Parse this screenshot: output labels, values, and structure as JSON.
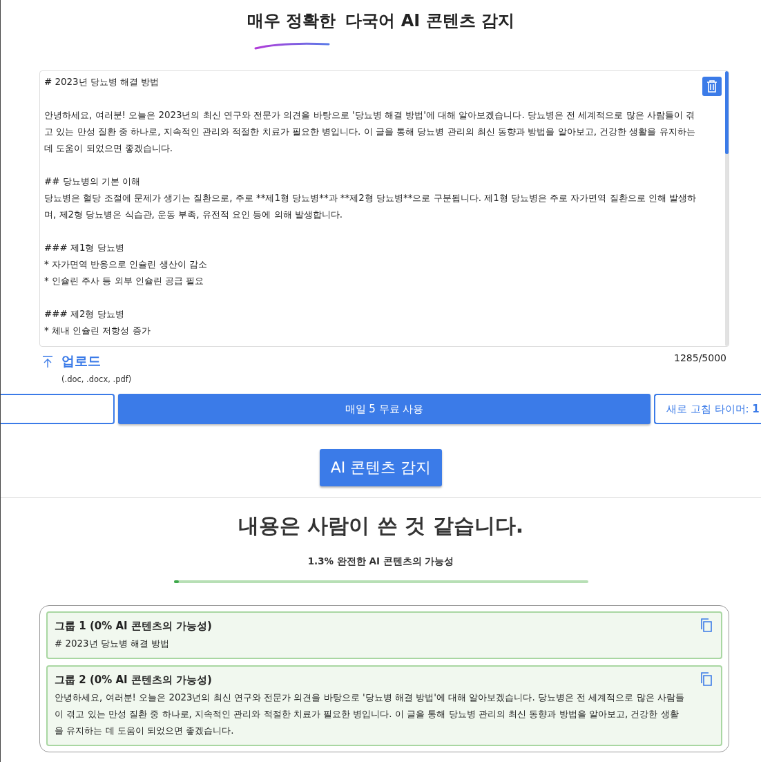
{
  "header": {
    "title_highlight": "매우 정확한",
    "title_rest": "다국어 AI 콘텐츠 감지"
  },
  "editor": {
    "blocks": [
      [
        "# 2023년 당뇨병 해결 방법"
      ],
      [
        "안녕하세요, 여러분! 오늘은 2023년의 최신 연구와 전문가 의견을 바탕으로 '당뇨병 해결 방법'에 대해 알아보겠습니다. 당뇨병은 전 세계적으로 많은 사람들이 겪고 있는 만성 질환 중 하나로, 지속적인 관리와 적절한 치료가 필요한 병입니다. 이 글을 통해 당뇨병 관리의 최신 동향과 방법을 알아보고, 건강한 생활을 유지하는 데 도움이 되었으면 좋겠습니다."
      ],
      [
        "## 당뇨병의 기본 이해",
        "당뇨병은 혈당 조절에 문제가 생기는 질환으로, 주로 **제1형 당뇨병**과 **제2형 당뇨병**으로 구분됩니다. 제1형 당뇨병은 주로 자가면역 질환으로 인해 발생하며, 제2형 당뇨병은 식습관, 운동 부족, 유전적 요인 등에 의해 발생합니다."
      ],
      [
        "### 제1형 당뇨병",
        "* 자가면역 반응으로 인슐린 생산이 감소",
        "* 인슐린 주사 등 외부 인슐린 공급 필요"
      ],
      [
        "### 제2형 당뇨병",
        "* 체내 인슐린 저항성 증가"
      ]
    ],
    "upload_label": "업로드",
    "upload_formats": "(.doc, .docx, .pdf)",
    "counter": "1285/5000"
  },
  "usage_bar": {
    "free_uses": "매일 5 무료 사용",
    "timer": "새로 고침 타이머: **1**"
  },
  "detect_button": "AI 콘텐츠 감지",
  "result": {
    "verdict": "내용은 사람이 쓴 것 같습니다.",
    "probability_label": "1.3% 완전한 AI 콘텐츠의 가능성",
    "level": 0.013,
    "groups": [
      {
        "title": "그룹 1 (0% AI 콘텐츠의 가능성)",
        "text": "# 2023년 당뇨병 해결 방법"
      },
      {
        "title": "그룹 2 (0% AI 콘텐츠의 가능성)",
        "text": "안녕하세요, 여러분!  오늘은 2023년의 최신 연구와 전문가 의견을 바탕으로 '당뇨병 해결 방법'에 대해 알아보겠습니다.  당뇨병은 전 세계적으로 많은 사람들이 겪고 있는 만성 질환 중 하나로, 지속적인 관리와 적절한 치료가 필요한 병입니다.  이 글을 통해 당뇨병 관리의 최신 동향과 방법을 알아보고, 건강한 생활을 유지하는 데 도움이 되었으면 좋겠습니다."
      }
    ]
  }
}
